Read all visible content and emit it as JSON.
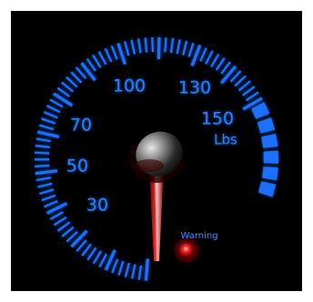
{
  "gauge": {
    "scale_labels": [
      "30",
      "50",
      "70",
      "100",
      "130",
      "150"
    ],
    "unit": "Lbs",
    "warning_label": "Warning",
    "needle_icon": "needle-icon",
    "hub_icon": "hub-knob-icon",
    "warning_light_icon": "warning-light-icon",
    "colors": {
      "scale": "#1e6fff",
      "scale_glow": "#3aa0ff",
      "needle": "#d00000",
      "warning_light": "#ff1a1a",
      "background": "#000000"
    }
  }
}
